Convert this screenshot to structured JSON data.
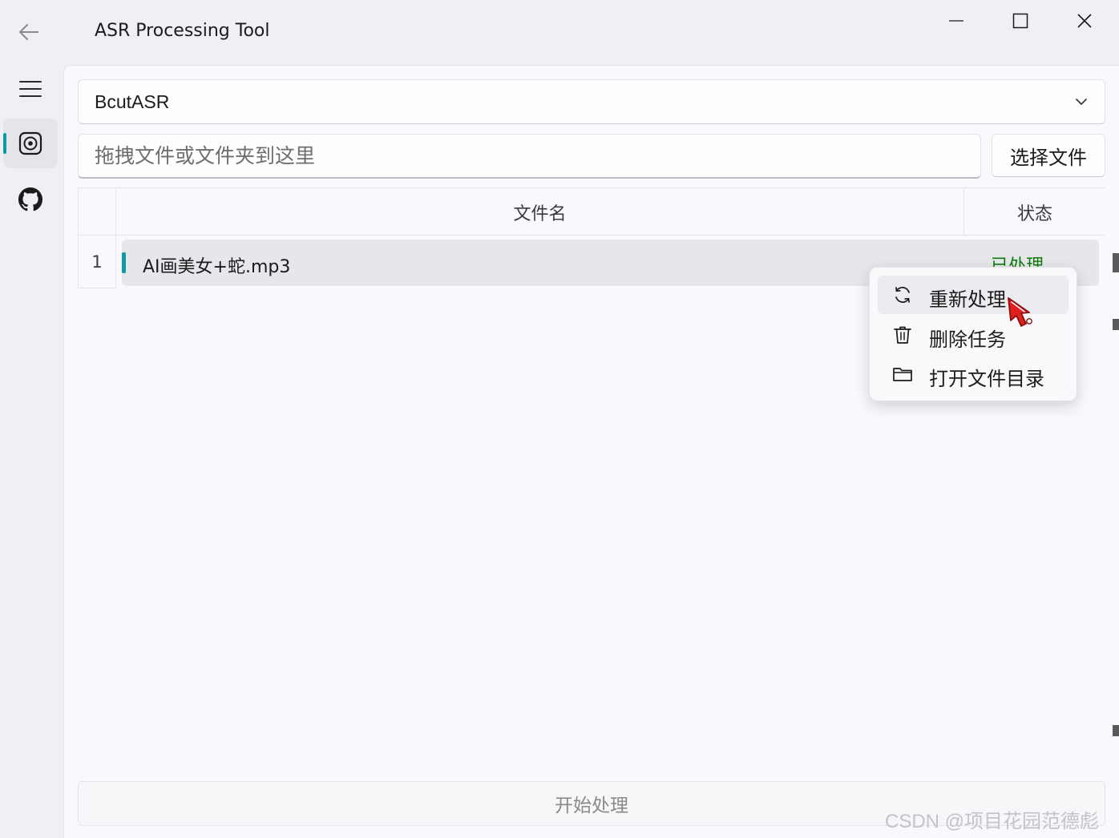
{
  "window": {
    "title": "ASR Processing Tool"
  },
  "engine": {
    "selected": "BcutASR"
  },
  "file_input": {
    "placeholder": "拖拽文件或文件夹到这里",
    "select_button": "选择文件"
  },
  "table": {
    "columns": [
      "文件名",
      "状态"
    ],
    "rows": [
      {
        "index": "1",
        "filename": "AI画美女+蛇.mp3",
        "status": "已处理"
      }
    ]
  },
  "context_menu": {
    "items": [
      {
        "label": "重新处理",
        "icon": "refresh-icon"
      },
      {
        "label": "删除任务",
        "icon": "trash-icon"
      },
      {
        "label": "打开文件目录",
        "icon": "folder-icon"
      }
    ]
  },
  "actions": {
    "start_label": "开始处理"
  },
  "watermark": "CSDN @项目花园范德彪",
  "colors": {
    "accent": "#0d9aa6",
    "status_done": "#0f7b0f"
  }
}
